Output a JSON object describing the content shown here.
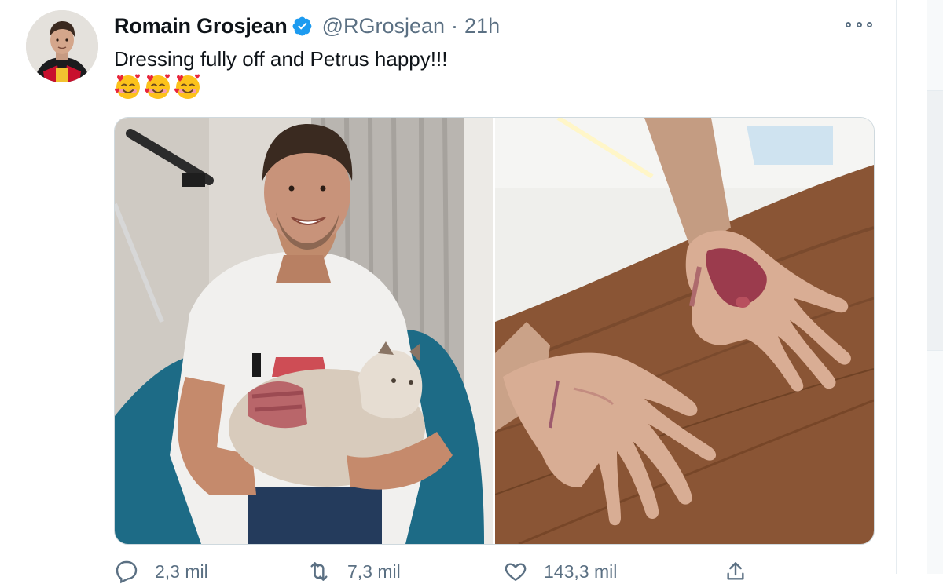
{
  "tweet": {
    "author_name": "Romain Grosjean",
    "handle": "@RGrosjean",
    "separator": "·",
    "time": "21h",
    "text": "Dressing fully off and Petrus happy!!!",
    "emojis": [
      "smiling-face-with-hearts",
      "smiling-face-with-hearts",
      "smiling-face-with-hearts"
    ],
    "verified": true
  },
  "actions": {
    "replies": "2,3 mil",
    "retweets": "7,3 mil",
    "likes": "143,3 mil"
  },
  "colors": {
    "verified_blue": "#1d9bf0",
    "muted_text": "#5b7083",
    "border": "#cfd9de"
  },
  "icons": [
    "verified-badge-icon",
    "more-icon",
    "reply-icon",
    "retweet-icon",
    "like-icon",
    "share-icon"
  ]
}
